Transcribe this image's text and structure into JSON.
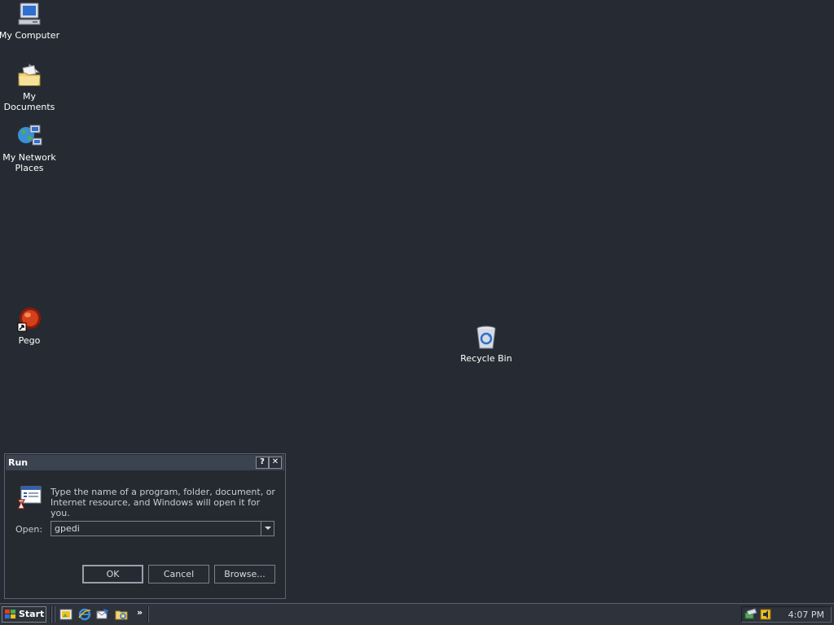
{
  "desktop": {
    "icons": [
      {
        "label": "My Computer",
        "icon": "computer-icon"
      },
      {
        "label": "My Documents",
        "icon": "folder-documents-icon"
      },
      {
        "label": "My Network Places",
        "icon": "network-places-icon"
      },
      {
        "label": "Pego",
        "icon": "pego-shortcut-icon"
      },
      {
        "label": "Recycle Bin",
        "icon": "recycle-bin-icon"
      }
    ]
  },
  "run_dialog": {
    "title": "Run",
    "help_button": "?",
    "close_button": "✕",
    "description": "Type the name of a program, folder, document, or Internet resource, and Windows will open it for you.",
    "open_label": "Open:",
    "open_value": "gpedi",
    "ok_label": "OK",
    "cancel_label": "Cancel",
    "browse_label": "Browse..."
  },
  "taskbar": {
    "start_label": "Start",
    "quick_launch": [
      "show-desktop-icon",
      "internet-explorer-icon",
      "outlook-express-icon",
      "explorer-icon"
    ],
    "chevron": "»",
    "clock": "4:07 PM"
  },
  "colors": {
    "desktop_bg": "#262b33",
    "titlebar": "#3c4350",
    "text": "#ffffff"
  }
}
